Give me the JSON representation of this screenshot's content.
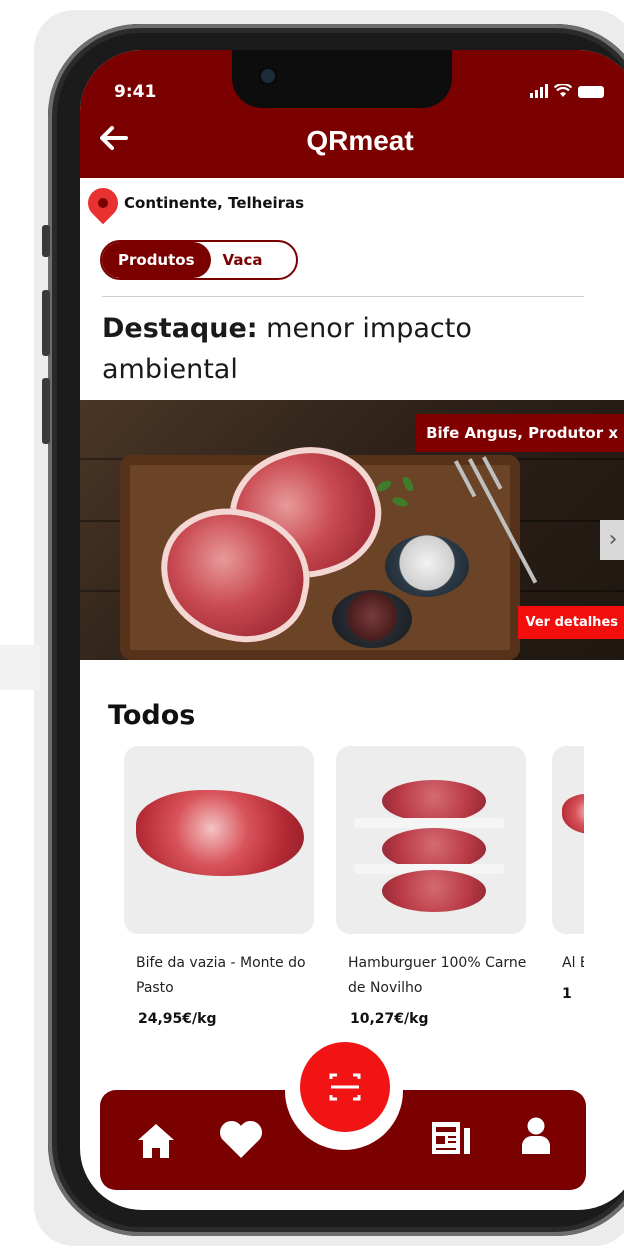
{
  "status_bar": {
    "time": "9:41"
  },
  "header": {
    "back_icon": "arrow-left-icon",
    "title": "QRmeat"
  },
  "location": {
    "icon": "map-pin-icon",
    "text": "Continente, Telheiras"
  },
  "breadcrumb": {
    "active": "Produtos",
    "current": "Vaca"
  },
  "featured": {
    "title_bold": "Destaque:",
    "title_rest": " menor impacto ambiental",
    "tag": "Bife Angus, Produtor x",
    "details_button": "Ver detalhes",
    "next_icon": "chevron-right-icon"
  },
  "all_products": {
    "title": "Todos",
    "items": [
      {
        "name": "Bife da vazia - Monte do Pasto",
        "price": "24,95€/kg"
      },
      {
        "name": "Hamburguer 100% Carne de Novilho",
        "price": "10,27€/kg"
      },
      {
        "name": "Al Bo",
        "price": "1"
      }
    ]
  },
  "bottom_nav": {
    "items": [
      "home-icon",
      "heart-icon",
      "scan-icon",
      "news-icon",
      "user-icon"
    ]
  },
  "colors": {
    "primary": "#7b0000",
    "accent": "#f21414"
  }
}
